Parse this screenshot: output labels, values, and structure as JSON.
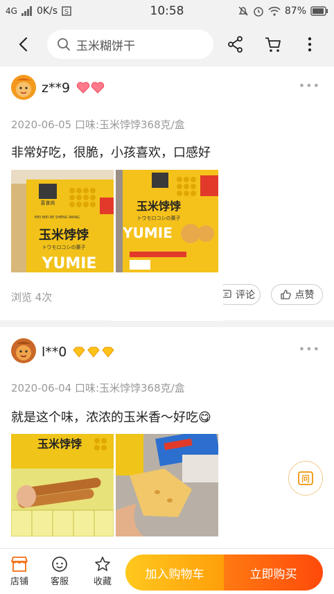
{
  "status_bar": {
    "network": "4G",
    "speed": "0K/s",
    "time": "10:58",
    "battery": "87%"
  },
  "header": {
    "search_text": "玉米糊饼干"
  },
  "reviews": [
    {
      "username": "z**9",
      "date_flavor": "2020-06-05 口味:玉米饽饽368克/盒",
      "content": "非常好吃，很脆，小孩喜欢，口感好",
      "views": "浏览 4次",
      "comment_label": "评论",
      "like_label": "点赞",
      "badge": "heart-badges",
      "photo_texts": [
        "喜食尚",
        "玉米饽饽",
        "トウモロコシの菓子",
        "YUMIE",
        "MEI WEI RE SHENG WANG"
      ]
    },
    {
      "username": "l**0",
      "date_flavor": "2020-06-04 口味:玉米饽饽368克/盒",
      "content": "就是这个味，浓浓的玉米香～好吃😋",
      "badge": "diamond-badges",
      "photo_texts": [
        "玉米饽饽"
      ]
    }
  ],
  "floating": {
    "ask_label": "问"
  },
  "bottom_bar": {
    "store_label": "店铺",
    "service_label": "客服",
    "favorite_label": "收藏",
    "add_cart_label": "加入购物车",
    "buy_now_label": "立即购买"
  },
  "colors": {
    "accent_orange": "#ff5a0a",
    "accent_yellow": "#ffc81e",
    "background": "#f2f2f2"
  }
}
